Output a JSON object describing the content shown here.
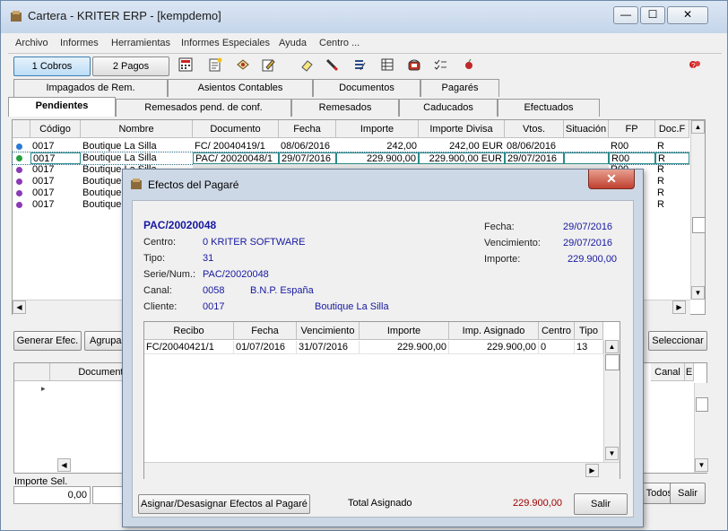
{
  "window": {
    "title": "Cartera - KRITER ERP - [kempdemo]",
    "minimize": "—",
    "maximize": "☐",
    "close": "✕"
  },
  "menu": [
    "Archivo",
    "Informes",
    "Herramientas",
    "Informes Especiales",
    "Ayuda",
    "Centro ..."
  ],
  "buttons": {
    "cobros": "1 Cobros",
    "pagos": "2 Pagos"
  },
  "tabs_row1": [
    "Impagados de Rem.",
    "Asientos Contables",
    "Documentos",
    "Pagarés"
  ],
  "tabs_row2": [
    "Pendientes",
    "Remesados pend. de conf.",
    "Remesados",
    "Caducados",
    "Efectuados"
  ],
  "main_grid": {
    "columns": [
      "Código",
      "Nombre",
      "Documento",
      "Fecha",
      "Importe",
      "Importe Divisa",
      "Vtos.",
      "Situación",
      "FP",
      "Doc.F"
    ],
    "rows": [
      {
        "codigo": "0017",
        "nombre": "Boutique La Silla",
        "documento": "FC/ 20040419/1",
        "fecha": "08/06/2016",
        "importe": "242,00",
        "divisa": "242,00 EUR",
        "vtos": "08/06/2016",
        "situacion": "",
        "fp": "R00",
        "docf": "R"
      },
      {
        "codigo": "0017",
        "nombre": "Boutique La Silla",
        "documento": "PAC/ 20020048/1",
        "fecha": "29/07/2016",
        "importe": "229.900,00",
        "divisa": "229.900,00 EUR",
        "vtos": "29/07/2016",
        "situacion": "",
        "fp": "R00",
        "docf": "R"
      },
      {
        "codigo": "0017",
        "nombre": "Boutique La Silla",
        "documento": "",
        "fecha": "",
        "importe": "",
        "divisa": "",
        "vtos": "",
        "situacion": "",
        "fp": "R00",
        "docf": "R"
      },
      {
        "codigo": "0017",
        "nombre": "Boutique",
        "documento": "",
        "fecha": "",
        "importe": "",
        "divisa": "",
        "vtos": "",
        "situacion": "",
        "fp": "",
        "docf": "R"
      },
      {
        "codigo": "0017",
        "nombre": "Boutique",
        "documento": "",
        "fecha": "",
        "importe": "",
        "divisa": "",
        "vtos": "",
        "situacion": "",
        "fp": "",
        "docf": "R"
      },
      {
        "codigo": "0017",
        "nombre": "Boutique",
        "documento": "",
        "fecha": "",
        "importe": "",
        "divisa": "",
        "vtos": "",
        "situacion": "",
        "fp": "",
        "docf": "R"
      }
    ]
  },
  "main_bottom": {
    "generar": "Generar Efec.",
    "agrupar": "Agrupar",
    "seleccionar": "Seleccionar",
    "documento_col": "Documento",
    "canal_col": "Canal",
    "e_col": "E",
    "importe_sel_label": "Importe Sel.",
    "importe_sel_value": "0,00",
    "todos": "Todos",
    "salir": "Salir"
  },
  "dialog": {
    "title": "Efectos del Pagaré",
    "close": "✕",
    "header": {
      "doc": "PAC/20020048",
      "centro_label": "Centro:",
      "centro_value": "0  KRITER SOFTWARE",
      "tipo_label": "Tipo:",
      "tipo_value": "31",
      "serie_label": "Serie/Num.:",
      "serie_value": "PAC/20020048",
      "canal_label": "Canal:",
      "canal_code": "0058",
      "canal_name": "B.N.P. España",
      "cliente_label": "Cliente:",
      "cliente_code": "0017",
      "cliente_name": "Boutique La Silla",
      "fecha_label": "Fecha:",
      "fecha_value": "29/07/2016",
      "venc_label": "Vencimiento:",
      "venc_value": "29/07/2016",
      "importe_label": "Importe:",
      "importe_value": "229.900,00"
    },
    "grid": {
      "columns": [
        "Recibo",
        "Fecha",
        "Vencimiento",
        "Importe",
        "Imp. Asignado",
        "Centro",
        "Tipo"
      ],
      "rows": [
        {
          "recibo": "FC/20040421/1",
          "fecha": "01/07/2016",
          "venc": "31/07/2016",
          "importe": "229.900,00",
          "asignado": "229.900,00",
          "centro": "0",
          "tipo": "13"
        }
      ]
    },
    "footer": {
      "asignar": "Asignar/Desasignar Efectos al Pagaré",
      "total_label": "Total Asignado",
      "total_value": "229.900,00",
      "salir": "Salir"
    }
  },
  "colors": {
    "accent_blue": "#1818a0",
    "total_red": "#a00000"
  }
}
